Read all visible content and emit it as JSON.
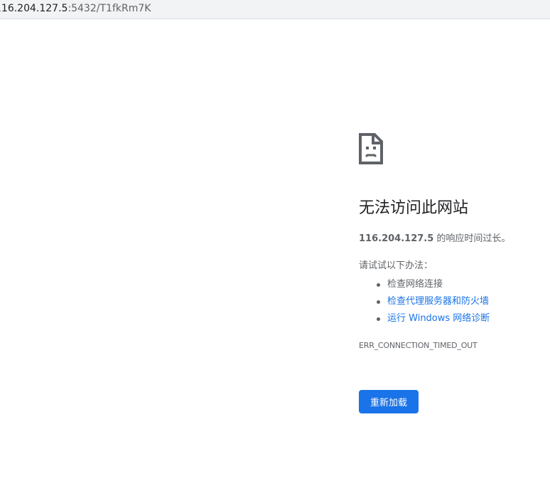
{
  "address_bar": {
    "url_host": "116.204.127.5",
    "url_rest": ":5432/T1fkRm7K"
  },
  "error_page": {
    "icon": "sad-page-icon",
    "heading": "无法访问此网站",
    "summary_host": "116.204.127.5",
    "summary_text": " 的响应时间过长。",
    "suggestions_title": "请试试以下办法：",
    "suggestions": [
      {
        "label": "检查网络连接",
        "is_link": false
      },
      {
        "label": "检查代理服务器和防火墙",
        "is_link": true
      },
      {
        "label": "运行 Windows 网络诊断",
        "is_link": true
      }
    ],
    "error_code": "ERR_CONNECTION_TIMED_OUT",
    "reload_label": "重新加载"
  },
  "colors": {
    "link": "#1a73e8",
    "button_bg": "#1a73e8",
    "text_secondary": "#5f6368",
    "heading": "#202124"
  }
}
